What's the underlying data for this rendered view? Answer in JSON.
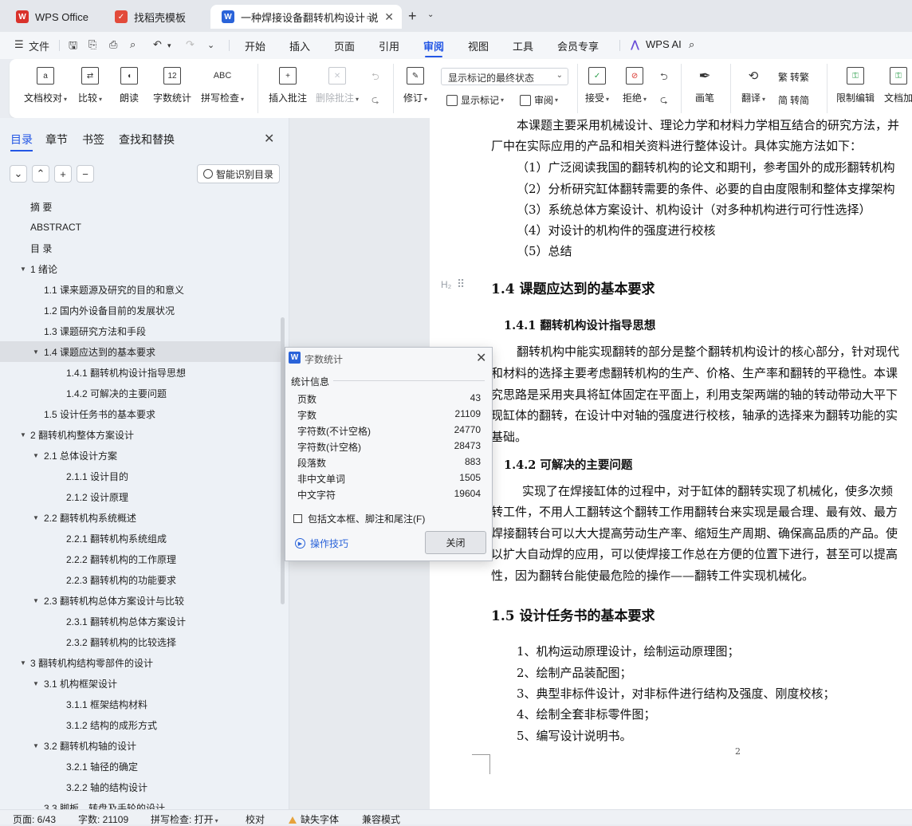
{
  "tabs": [
    {
      "label": "WPS Office",
      "icon": "wps-logo-icon"
    },
    {
      "label": "找稻壳模板",
      "icon": "docer-logo-icon"
    },
    {
      "label": "一种焊接设备翻转机构设计 说",
      "icon": "word-doc-icon"
    }
  ],
  "menu": {
    "file": "文件",
    "items": [
      "开始",
      "插入",
      "页面",
      "引用",
      "审阅",
      "视图",
      "工具",
      "会员专享"
    ],
    "active": "审阅",
    "wps_ai": "WPS AI"
  },
  "ribbon": {
    "proofread": "文档校对",
    "compare": "比较",
    "read_aloud": "朗读",
    "word_count": "字数统计",
    "word_count_icon_text": "12",
    "spell_check": "拼写检查",
    "spell_check_icon_text": "ABC",
    "insert_comment": "插入批注",
    "delete_comment": "删除批注",
    "revise": "修订",
    "markup_mode": "显示标记的最终状态",
    "show_markup": "显示标记",
    "review": "审阅",
    "accept": "接受",
    "reject": "拒绝",
    "pen": "画笔",
    "translate": "翻译",
    "to_traditional": "转繁",
    "to_simplified": "转简",
    "restrict_edit": "限制编辑",
    "doc_protect": "文档加"
  },
  "panel": {
    "tabs": [
      "目录",
      "章节",
      "书签",
      "查找和替换"
    ],
    "active_tab": "目录",
    "smart_toc": "智能识别目录",
    "toc": [
      {
        "label": "摘  要",
        "level": 0
      },
      {
        "label": "ABSTRACT",
        "level": 0
      },
      {
        "label": "目  录",
        "level": 0
      },
      {
        "label": "1  绪论",
        "level": 1,
        "expanded": true
      },
      {
        "label": "1.1  课来题源及研究的目的和意义",
        "level": 2
      },
      {
        "label": "1.2  国内外设备目前的发展状况",
        "level": 2
      },
      {
        "label": "1.3  课题研究方法和手段",
        "level": 2
      },
      {
        "label": "1.4  课题应达到的基本要求",
        "level": 2,
        "expanded": true,
        "selected": true
      },
      {
        "label": "1.4.1  翻转机构设计指导思想",
        "level": 3
      },
      {
        "label": "1.4.2  可解决的主要问题",
        "level": 3
      },
      {
        "label": "1.5  设计任务书的基本要求",
        "level": 2
      },
      {
        "label": "2  翻转机构整体方案设计",
        "level": 1,
        "expanded": true
      },
      {
        "label": "2.1  总体设计方案",
        "level": 2,
        "expanded": true
      },
      {
        "label": "2.1.1  设计目的",
        "level": 3
      },
      {
        "label": "2.1.2  设计原理",
        "level": 3
      },
      {
        "label": "2.2  翻转机构系统概述",
        "level": 2,
        "expanded": true
      },
      {
        "label": "2.2.1  翻转机构系统组成",
        "level": 3
      },
      {
        "label": "2.2.2  翻转机构的工作原理",
        "level": 3
      },
      {
        "label": "2.2.3  翻转机构的功能要求",
        "level": 3
      },
      {
        "label": "2.3  翻转机构总体方案设计与比较",
        "level": 2,
        "expanded": true
      },
      {
        "label": "2.3.1  翻转机构总体方案设计",
        "level": 3
      },
      {
        "label": "2.3.2  翻转机构的比较选择",
        "level": 3
      },
      {
        "label": "3  翻转机构结构零部件的设计",
        "level": 1,
        "expanded": true
      },
      {
        "label": "3.1  机构框架设计",
        "level": 2,
        "expanded": true
      },
      {
        "label": "3.1.1  框架结构材料",
        "level": 3
      },
      {
        "label": "3.1.2  结构的成形方式",
        "level": 3
      },
      {
        "label": "3.2  翻转机构轴的设计",
        "level": 2,
        "expanded": true
      },
      {
        "label": "3.2.1  轴径的确定",
        "level": 3
      },
      {
        "label": "3.2.2  轴的结构设计",
        "level": 3
      },
      {
        "label": "3.3  脚板、转盘及手轮的设计",
        "level": 2
      }
    ]
  },
  "document": {
    "h2_marker": "H₂",
    "paragraphs": [
      "本课题主要采用机械设计、理论力学和材料力学相互结合的研究方法，并",
      "厂中在实际应用的产品和相关资料进行整体设计。具体实施方法如下：",
      "（1）广泛阅读我国的翻转机构的论文和期刊，参考国外的成形翻转机构",
      "（2）分析研究缸体翻转需要的条件、必要的自由度限制和整体支撑架构",
      "（3）系统总体方案设计、机构设计（对多种机构进行可行性选择）",
      "（4）对设计的机构件的强度进行校核",
      "（5）总结"
    ],
    "heading_1_4": "1.4  课题应达到的基本要求",
    "heading_1_4_1": "1.4.1  翻转机构设计指导思想",
    "para_1_4_1": [
      "翻转机构中能实现翻转的部分是整个翻转机构设计的核心部分，针对现代",
      "和材料的选择主要考虑翻转机构的生产、价格、生产率和翻转的平稳性。本课",
      "究思路是采用夹具将缸体固定在平面上，利用支架两端的轴的转动带动大平下",
      "现缸体的翻转，在设计中对轴的强度进行校核，轴承的选择来为翻转功能的实",
      "基础。"
    ],
    "heading_1_4_2": "1.4.2  可解决的主要问题",
    "para_1_4_2": [
      "实现了在焊接缸体的过程中，对于缸体的翻转实现了机械化，使多次频",
      "转工件，不用人工翻转这个翻转工作用翻转台来实现是最合理、最有效、最方",
      "焊接翻转台可以大大提高劳动生产率、缩短生产周期、确保高品质的产品。使",
      "以扩大自动焊的应用，可以使焊接工作总在方便的位置下进行，甚至可以提高",
      "性，因为翻转台能使最危险的操作——翻转工件实现机械化。"
    ],
    "heading_1_5": "1.5  设计任务书的基本要求",
    "list_1_5": [
      "1、机构运动原理设计，绘制运动原理图；",
      "2、绘制产品装配图；",
      "3、典型非标件设计，对非标件进行结构及强度、刚度校核；",
      "4、绘制全套非标零件图；",
      "5、编写设计说明书。"
    ],
    "page_number": "2"
  },
  "dialog": {
    "title": "字数统计",
    "group": "统计信息",
    "stats": [
      {
        "label": "页数",
        "value": "43"
      },
      {
        "label": "字数",
        "value": "21109"
      },
      {
        "label": "字符数(不计空格)",
        "value": "24770"
      },
      {
        "label": "字符数(计空格)",
        "value": "28473"
      },
      {
        "label": "段落数",
        "value": "883"
      },
      {
        "label": "非中文单词",
        "value": "1505"
      },
      {
        "label": "中文字符",
        "value": "19604"
      }
    ],
    "include_label": "包括文本框、脚注和尾注(F)",
    "tips": "操作技巧",
    "close": "关闭"
  },
  "status": {
    "page": "页面: 6/43",
    "words": "字数: 21109",
    "spell": "拼写检查: 打开",
    "proof": "校对",
    "missing_font": "缺失字体",
    "compat": "兼容模式"
  }
}
